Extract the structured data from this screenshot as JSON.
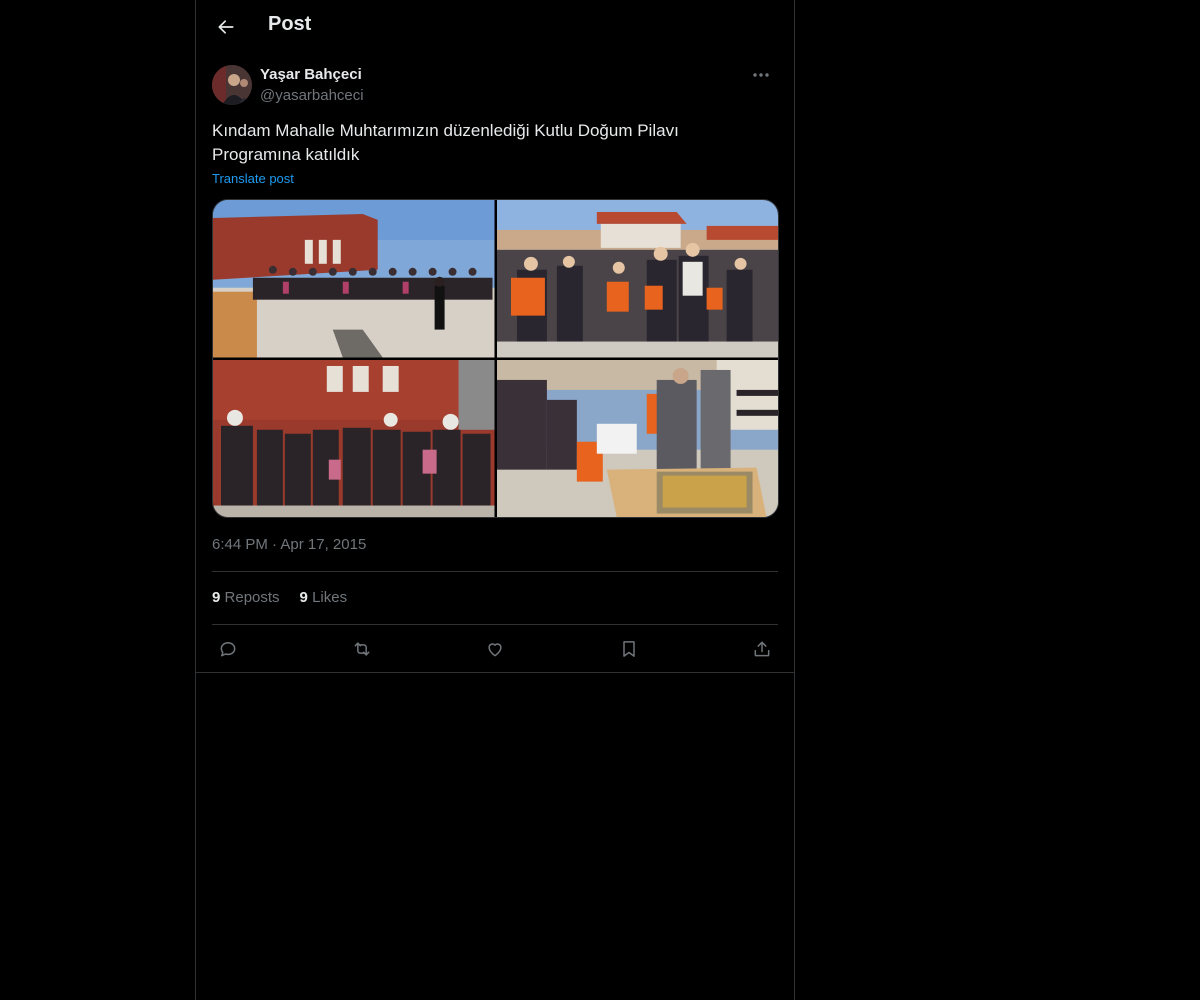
{
  "header": {
    "title": "Post"
  },
  "post": {
    "author_name": "Yaşar Bahçeci",
    "author_handle": "@yasarbahceci",
    "text": "Kındam Mahalle Muhtarımızın düzenlediği Kutlu Doğum Pilavı Programına katıldık",
    "translate_label": "Translate post",
    "time": "6:44 PM",
    "separator": "·",
    "date": "Apr 17, 2015"
  },
  "stats": {
    "reposts_count": "9",
    "reposts_label": "Reposts",
    "likes_count": "9",
    "likes_label": "Likes"
  },
  "icons": {
    "back": "arrow-left-icon",
    "more": "more-horizontal-icon",
    "reply": "reply-icon",
    "repost": "repost-icon",
    "like": "heart-icon",
    "bookmark": "bookmark-icon",
    "share": "share-icon"
  },
  "colors": {
    "background": "#000000",
    "text": "#e7e9ea",
    "muted": "#71767b",
    "accent": "#1d9bf0",
    "border": "#2f3336"
  }
}
